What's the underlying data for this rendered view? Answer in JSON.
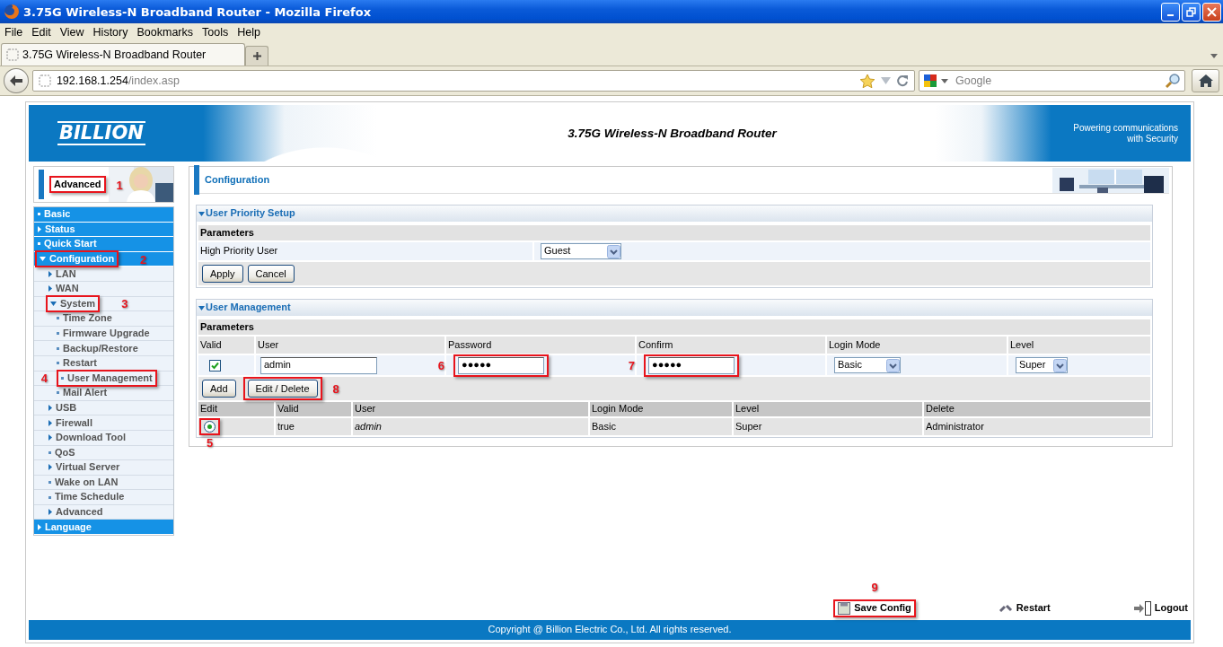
{
  "window": {
    "title": "3.75G Wireless-N Broadband Router - Mozilla Firefox"
  },
  "menu_bar": [
    "File",
    "Edit",
    "View",
    "History",
    "Bookmarks",
    "Tools",
    "Help"
  ],
  "tabs": [
    {
      "label": "3.75G Wireless-N Broadband Router",
      "selected": true
    }
  ],
  "address_bar": {
    "host": "192.168.1.254",
    "path": "/index.asp"
  },
  "search": {
    "placeholder": "Google"
  },
  "banner": {
    "logo": "BILLION",
    "title": "3.75G Wireless-N Broadband Router",
    "slogan": [
      "Powering communications",
      "with Security"
    ]
  },
  "mode": {
    "label": "Advanced",
    "callout": "1"
  },
  "sidebar": [
    {
      "label": "Basic",
      "kind": "page"
    },
    {
      "label": "Status",
      "kind": "folder",
      "expanded": false
    },
    {
      "label": "Quick Start",
      "kind": "page"
    },
    {
      "label": "Configuration",
      "kind": "folder",
      "expanded": true,
      "callout": "2",
      "children": [
        {
          "label": "LAN",
          "kind": "folder",
          "expanded": false
        },
        {
          "label": "WAN",
          "kind": "folder",
          "expanded": false
        },
        {
          "label": "System",
          "kind": "folder",
          "expanded": true,
          "callout": "3",
          "children": [
            {
              "label": "Time Zone",
              "kind": "page"
            },
            {
              "label": "Firmware Upgrade",
              "kind": "page"
            },
            {
              "label": "Backup/Restore",
              "kind": "page"
            },
            {
              "label": "Restart",
              "kind": "page"
            },
            {
              "label": "User Management",
              "kind": "page",
              "callout": "4"
            },
            {
              "label": "Mail Alert",
              "kind": "page"
            }
          ]
        },
        {
          "label": "USB",
          "kind": "folder",
          "expanded": false
        },
        {
          "label": "Firewall",
          "kind": "folder",
          "expanded": false
        },
        {
          "label": "Download Tool",
          "kind": "folder",
          "expanded": false
        },
        {
          "label": "QoS",
          "kind": "page"
        },
        {
          "label": "Virtual Server",
          "kind": "folder",
          "expanded": false
        },
        {
          "label": "Wake on LAN",
          "kind": "page"
        },
        {
          "label": "Time Schedule",
          "kind": "page"
        },
        {
          "label": "Advanced",
          "kind": "folder",
          "expanded": false
        }
      ]
    },
    {
      "label": "Language",
      "kind": "folder",
      "expanded": false
    }
  ],
  "page_title": "Configuration",
  "user_priority_setup": {
    "title": "User Priority Setup",
    "expanded": true,
    "parameters": "Parameters",
    "field_label": "High Priority User",
    "value": "Guest",
    "buttons": [
      "Apply",
      "Cancel"
    ]
  },
  "user_management": {
    "title": "User Management",
    "expanded": true,
    "parameters": "Parameters",
    "columns": [
      "Valid",
      "User",
      "Password",
      "Confirm",
      "Login Mode",
      "Level"
    ],
    "entry": {
      "valid": true,
      "user": "admin",
      "password": "●●●●●",
      "password_callout": "6",
      "confirm": "●●●●●",
      "confirm_callout": "7",
      "login_mode": "Basic",
      "level": "Super"
    },
    "buttons": [
      {
        "label": "Add"
      },
      {
        "label": "Edit / Delete",
        "callout": "8"
      }
    ],
    "list_columns": [
      "Edit",
      "Valid",
      "User",
      "Login Mode",
      "Level",
      "Delete"
    ],
    "rows": [
      {
        "selected": true,
        "callout": "5",
        "valid": "true",
        "user": "admin",
        "login_mode": "Basic",
        "level": "Super",
        "delete": "Administrator"
      }
    ]
  },
  "actions": [
    {
      "kind": "save",
      "label": "Save Config",
      "callout": "9"
    },
    {
      "kind": "restart",
      "label": "Restart"
    },
    {
      "kind": "logout",
      "label": "Logout"
    }
  ],
  "copyright": "Copyright @ Billion Electric Co., Ltd. All rights reserved."
}
